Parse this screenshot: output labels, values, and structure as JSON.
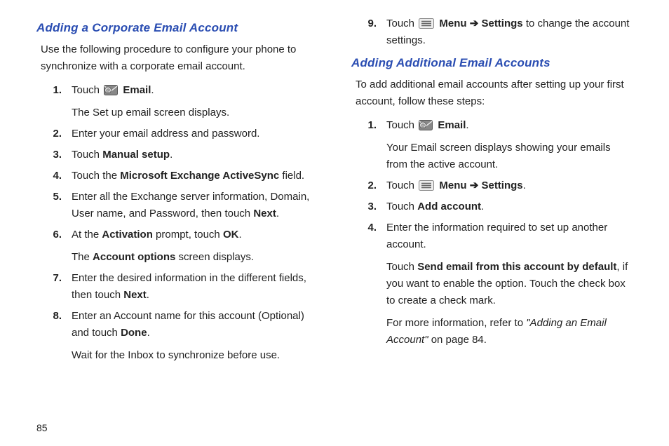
{
  "page_number": "85",
  "left": {
    "title": "Adding a Corporate Email Account",
    "intro": "Use the following procedure to configure your phone to synchronize with a corporate email account.",
    "steps": [
      {
        "n": "1.",
        "parts": [
          [
            {
              "t": "Touch "
            },
            {
              "icon": "email-icon"
            },
            {
              "t": " "
            },
            {
              "t": "Email",
              "b": true
            },
            {
              "t": "."
            }
          ],
          [
            {
              "t": "The Set up email screen displays."
            }
          ]
        ]
      },
      {
        "n": "2.",
        "parts": [
          [
            {
              "t": "Enter your email address and password."
            }
          ]
        ]
      },
      {
        "n": "3.",
        "parts": [
          [
            {
              "t": "Touch "
            },
            {
              "t": "Manual setup",
              "b": true
            },
            {
              "t": "."
            }
          ]
        ]
      },
      {
        "n": "4.",
        "parts": [
          [
            {
              "t": "Touch the "
            },
            {
              "t": "Microsoft Exchange ActiveSync",
              "b": true
            },
            {
              "t": " field."
            }
          ]
        ]
      },
      {
        "n": "5.",
        "parts": [
          [
            {
              "t": "Enter all the Exchange server information, Domain, User name, and Password, then touch "
            },
            {
              "t": "Next",
              "b": true
            },
            {
              "t": "."
            }
          ]
        ]
      },
      {
        "n": "6.",
        "parts": [
          [
            {
              "t": "At the "
            },
            {
              "t": "Activation",
              "b": true
            },
            {
              "t": " prompt, touch "
            },
            {
              "t": "OK",
              "b": true
            },
            {
              "t": "."
            }
          ],
          [
            {
              "t": "The "
            },
            {
              "t": "Account options",
              "b": true
            },
            {
              "t": " screen displays."
            }
          ]
        ]
      },
      {
        "n": "7.",
        "parts": [
          [
            {
              "t": "Enter the desired information in the different fields, then touch "
            },
            {
              "t": "Next",
              "b": true
            },
            {
              "t": "."
            }
          ]
        ]
      },
      {
        "n": "8.",
        "parts": [
          [
            {
              "t": "Enter an Account name for this account (Optional) and touch "
            },
            {
              "t": "Done",
              "b": true
            },
            {
              "t": "."
            }
          ],
          [
            {
              "t": "Wait for the Inbox to synchronize before use."
            }
          ]
        ]
      }
    ]
  },
  "right_top_steps": [
    {
      "n": "9.",
      "parts": [
        [
          {
            "t": "Touch "
          },
          {
            "icon": "menu-icon"
          },
          {
            "t": " "
          },
          {
            "t": "Menu",
            "b": true
          },
          {
            "t": " "
          },
          {
            "arrow": true
          },
          {
            "t": " "
          },
          {
            "t": "Settings",
            "b": true
          },
          {
            "t": " to change the account settings."
          }
        ]
      ]
    }
  ],
  "right": {
    "title": "Adding Additional Email Accounts",
    "intro": "To add additional email accounts after setting up your first account, follow these steps:",
    "steps": [
      {
        "n": "1.",
        "parts": [
          [
            {
              "t": "Touch "
            },
            {
              "icon": "email-icon"
            },
            {
              "t": " "
            },
            {
              "t": "Email",
              "b": true
            },
            {
              "t": "."
            }
          ],
          [
            {
              "t": "Your Email screen displays showing your emails from the active account."
            }
          ]
        ]
      },
      {
        "n": "2.",
        "parts": [
          [
            {
              "t": "Touch  "
            },
            {
              "icon": "menu-icon"
            },
            {
              "t": " "
            },
            {
              "t": "Menu",
              "b": true
            },
            {
              "t": " "
            },
            {
              "arrow": true
            },
            {
              "t": " "
            },
            {
              "t": "Settings",
              "b": true
            },
            {
              "t": "."
            }
          ]
        ]
      },
      {
        "n": "3.",
        "parts": [
          [
            {
              "t": "Touch "
            },
            {
              "t": "Add account",
              "b": true
            },
            {
              "t": "."
            }
          ]
        ]
      },
      {
        "n": "4.",
        "parts": [
          [
            {
              "t": "Enter the information required to set up another account."
            }
          ],
          [
            {
              "t": "Touch "
            },
            {
              "t": "Send email from this account by default",
              "b": true
            },
            {
              "t": ", if you want to enable the option. Touch the check box to create a check mark."
            }
          ],
          [
            {
              "t": "For more information, refer to "
            },
            {
              "t": "\"Adding an Email Account\"",
              "i": true
            },
            {
              "t": " on page 84."
            }
          ]
        ]
      }
    ]
  },
  "arrow_glyph": "➔"
}
